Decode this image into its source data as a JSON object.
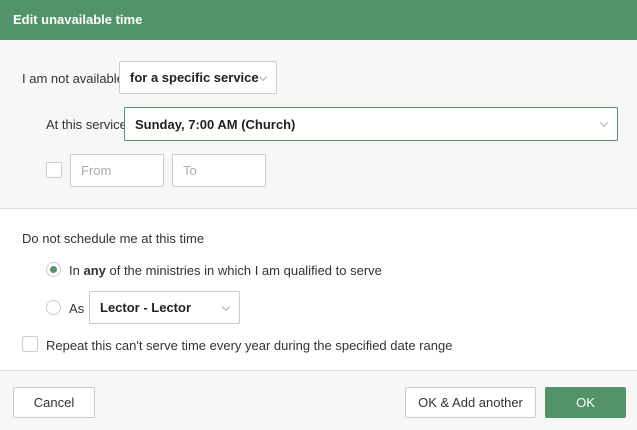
{
  "header": {
    "title": "Edit unavailable time"
  },
  "availability": {
    "label": "I am not available",
    "selected": "for a specific service"
  },
  "service": {
    "label": "At this service",
    "selected": "Sunday, 7:00 AM (Church)"
  },
  "time_range": {
    "from_placeholder": "From",
    "to_placeholder": "To"
  },
  "schedule": {
    "heading": "Do not schedule me at this time",
    "option_any_prefix": "In ",
    "option_any_bold": "any",
    "option_any_suffix": " of the ministries in which I am qualified to serve",
    "option_as_label": "As",
    "ministry_selected": "Lector - Lector",
    "repeat_label": "Repeat this can't serve time every year during the specified date range"
  },
  "footer": {
    "cancel": "Cancel",
    "ok_add_another": "OK & Add another",
    "ok": "OK"
  },
  "colors": {
    "accent": "#52936a"
  }
}
